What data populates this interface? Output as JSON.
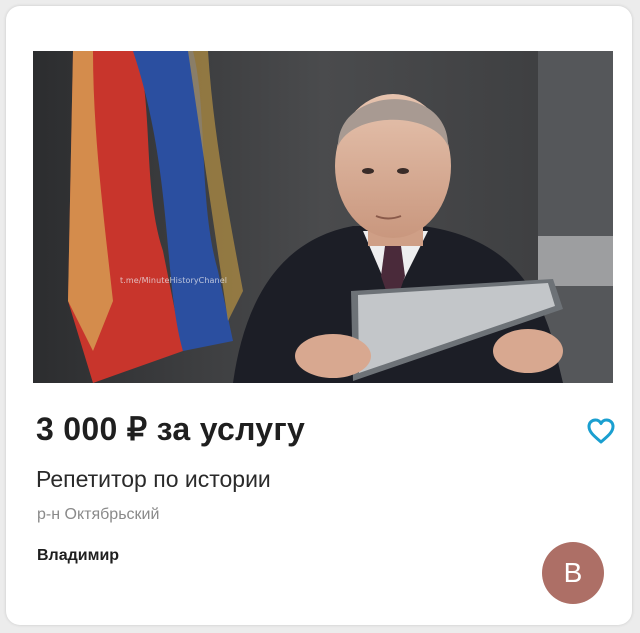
{
  "listing": {
    "photo_label": "t.me/MinuteHistoryChanel",
    "price": "3 000 ₽ за услугу",
    "title": "Репетитор по истории",
    "district": "р-н Октябрьский",
    "seller_name": "Владимир",
    "avatar_letter": "В"
  },
  "colors": {
    "accent": "#1a9fd0",
    "avatar_bg": "#ad6f66"
  },
  "icons": {
    "favorite": "heart-outline-icon"
  }
}
